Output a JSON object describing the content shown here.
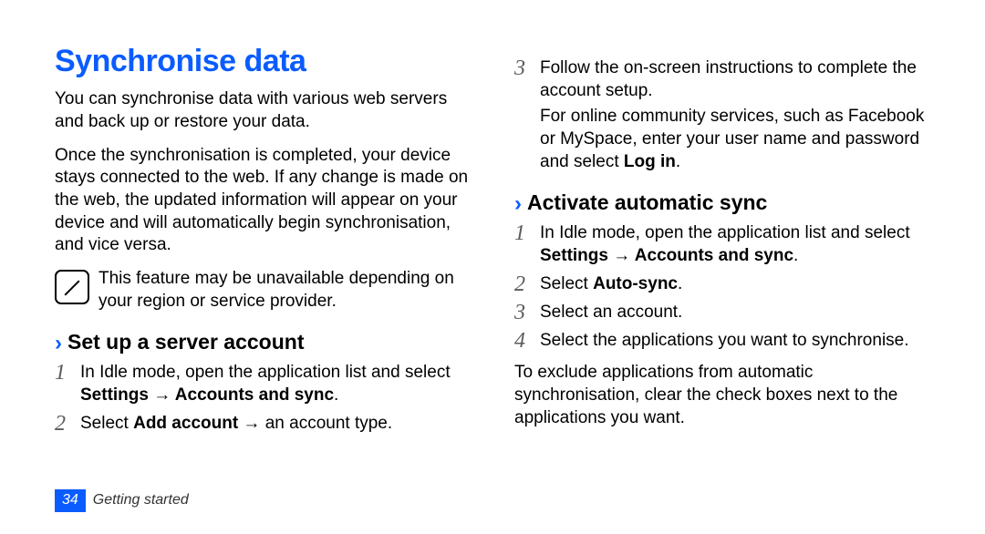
{
  "title": "Synchronise data",
  "intro_p1": "You can synchronise data with various web servers and back up or restore your data.",
  "intro_p2": "Once the synchronisation is completed, your device stays connected to the web. If any change is made on the web, the updated information will appear on your device and will automatically begin synchronisation, and vice versa.",
  "note": "This feature may be unavailable depending on your region or service provider.",
  "sub1": {
    "title": "Set up a server account",
    "steps": {
      "s1": {
        "num": "1",
        "pre": "In Idle mode, open the application list and select ",
        "bold": "Settings → Accounts and sync",
        "post": "."
      },
      "s2": {
        "num": "2",
        "pre": "Select ",
        "bold": "Add account",
        "post": " → an account type."
      },
      "s3": {
        "num": "3",
        "line1": "Follow the on-screen instructions to complete the account setup.",
        "line2_pre": "For online community services, such as Facebook or MySpace, enter your user name and password and select ",
        "line2_bold": "Log in",
        "line2_post": "."
      }
    }
  },
  "sub2": {
    "title": "Activate automatic sync",
    "steps": {
      "s1": {
        "num": "1",
        "pre": "In Idle mode, open the application list and select ",
        "bold": "Settings → Accounts and sync",
        "post": "."
      },
      "s2": {
        "num": "2",
        "pre": "Select ",
        "bold": "Auto-sync",
        "post": "."
      },
      "s3": {
        "num": "3",
        "text": "Select an account."
      },
      "s4": {
        "num": "4",
        "text": "Select the applications you want to synchronise."
      }
    },
    "outro": "To exclude applications from automatic synchronisation, clear the check boxes next to the applications you want."
  },
  "footer": {
    "page": "34",
    "section": "Getting started"
  }
}
